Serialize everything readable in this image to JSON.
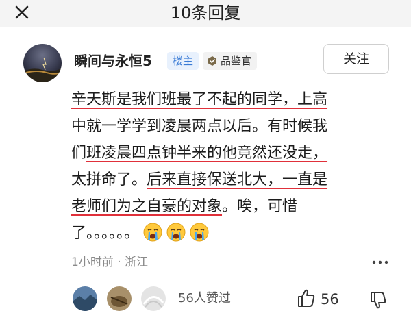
{
  "header": {
    "title": "10条回复"
  },
  "comment": {
    "username": "瞬间与永恒5",
    "op_badge": "楼主",
    "critic_badge": "品鉴官",
    "follow_label": "关注",
    "lines": [
      [
        {
          "t": "辛天斯是我们班最了不起的同学，上高",
          "u": true
        }
      ],
      [
        {
          "t": "中就一学学到凌晨两点以后。有时候我",
          "u": false
        }
      ],
      [
        {
          "t": "们",
          "u": false
        },
        {
          "t": "班凌晨四点钟半来的他竟然还没走，",
          "u": true
        }
      ],
      [
        {
          "t": "太拼命了。",
          "u": false
        },
        {
          "t": "后来直接保送北大，一直是",
          "u": true
        }
      ],
      [
        {
          "t": "老师们为之自豪的对象",
          "u": true
        },
        {
          "t": "。唉，可惜",
          "u": false
        }
      ],
      [
        {
          "t": "了。。。。。。",
          "u": false
        }
      ]
    ],
    "emoji": [
      "crying-face-emoji",
      "crying-face-emoji",
      "crying-face-emoji"
    ],
    "time": "1小时前",
    "location": "浙江",
    "likers_text": "56人赞过",
    "like_count": "56"
  },
  "icons": {
    "close": "close-icon",
    "more": "more-icon",
    "thumbs_up": "thumbs-up-icon",
    "thumbs_down": "thumbs-down-icon"
  },
  "colors": {
    "underline": "#e0303a",
    "op_badge_bg": "#e8f1fd",
    "op_badge_text": "#3a7bd5",
    "topbar_bg": "#f4f4f4",
    "meta_text": "#8a8a8a"
  }
}
